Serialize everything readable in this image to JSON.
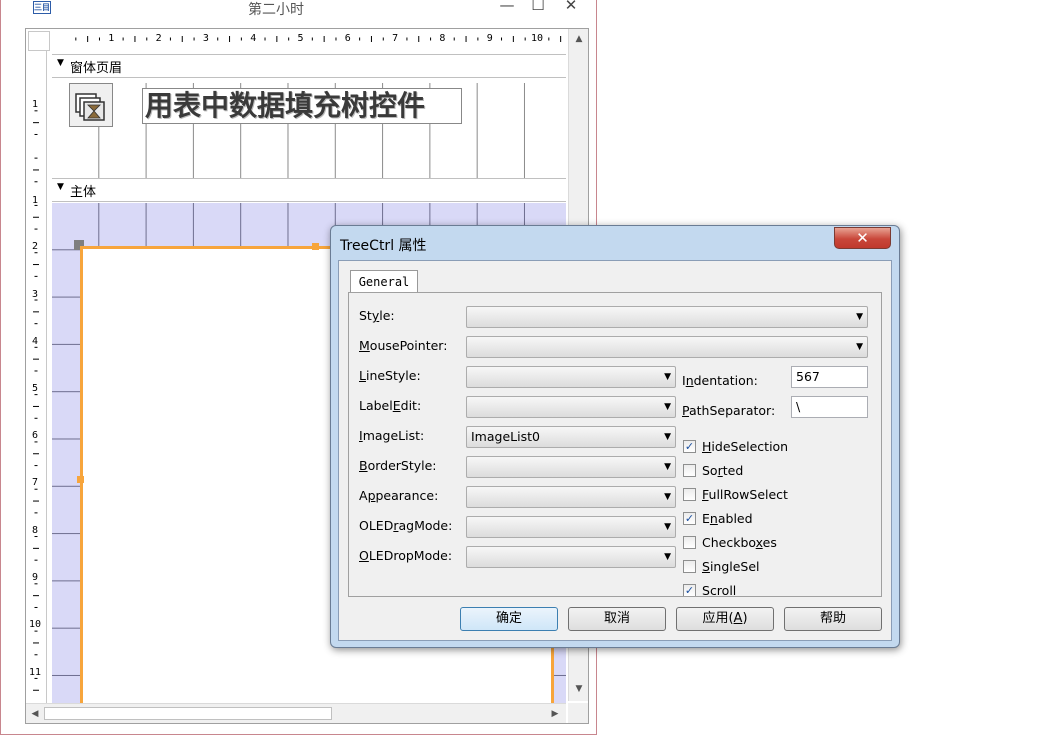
{
  "window": {
    "title": "第二小时",
    "icon": "access-form-icon",
    "minimize_glyph": "—",
    "maximize_glyph": "☐",
    "close_glyph": "✕"
  },
  "ruler": {
    "horizontal": [
      "1",
      "2",
      "3",
      "4",
      "5",
      "6",
      "7",
      "8",
      "9",
      "10"
    ],
    "vertical": [
      "1",
      "1",
      "2",
      "3",
      "4",
      "5",
      "6",
      "7",
      "8",
      "9",
      "10",
      "11"
    ]
  },
  "designer": {
    "header_section_label": "窗体页眉",
    "detail_section_label": "主体",
    "section_arrow_glyph": "▼",
    "title_label": "用表中数据填充树控件",
    "image_control_icon": "hourglass-image-icon"
  },
  "scrollbars": {
    "up": "▲",
    "down": "▼",
    "left": "◀",
    "right": "▶"
  },
  "dialog": {
    "title": "TreeCtrl 属性",
    "close_glyph": "✕",
    "tab": "General",
    "properties": [
      {
        "label_pre": "St",
        "label_key": "y",
        "label_post": "le:",
        "value": ""
      },
      {
        "label_pre": "",
        "label_key": "M",
        "label_post": "ousePointer:",
        "value": ""
      },
      {
        "label_pre": "",
        "label_key": "L",
        "label_post": "ineStyle:",
        "value": ""
      },
      {
        "label_pre": "Label",
        "label_key": "E",
        "label_post": "dit:",
        "value": ""
      },
      {
        "label_pre": "",
        "label_key": "I",
        "label_post": "mageList:",
        "value": "ImageList0"
      },
      {
        "label_pre": "",
        "label_key": "B",
        "label_post": "orderStyle:",
        "value": ""
      },
      {
        "label_pre": "A",
        "label_key": "p",
        "label_post": "pearance:",
        "value": ""
      },
      {
        "label_pre": "OLED",
        "label_key": "r",
        "label_post": "agMode:",
        "value": ""
      },
      {
        "label_pre": "",
        "label_key": "O",
        "label_post": "LEDropMode:",
        "value": ""
      }
    ],
    "indentation": {
      "label_pre": "I",
      "label_key": "n",
      "label_post": "dentation:",
      "value": "567"
    },
    "path_separator": {
      "label_pre": "",
      "label_key": "P",
      "label_post": "athSeparator:",
      "value": "\\"
    },
    "checkboxes": [
      {
        "label_pre": "",
        "label_key": "H",
        "label_post": "ideSelection",
        "checked": true
      },
      {
        "label_pre": "So",
        "label_key": "r",
        "label_post": "ted",
        "checked": false
      },
      {
        "label_pre": "",
        "label_key": "F",
        "label_post": "ullRowSelect",
        "checked": false
      },
      {
        "label_pre": "E",
        "label_key": "n",
        "label_post": "abled",
        "checked": true
      },
      {
        "label_pre": "Checkbo",
        "label_key": "x",
        "label_post": "es",
        "checked": false
      },
      {
        "label_pre": "",
        "label_key": "S",
        "label_post": "ingleSel",
        "checked": false
      },
      {
        "label_pre": "",
        "label_key": "S",
        "label_post": "croll",
        "checked": true
      }
    ],
    "check_glyph": "✓",
    "buttons": {
      "ok": "确定",
      "cancel": "取消",
      "apply_pre": "应用(",
      "apply_key": "A",
      "apply_post": ")",
      "help": "帮助"
    }
  },
  "colors": {
    "selection_orange": "#f7a53c",
    "detail_grid_fill": "#d9d9f7",
    "dialog_frame": "#c3d9ef",
    "close_red": "#c9473a"
  }
}
